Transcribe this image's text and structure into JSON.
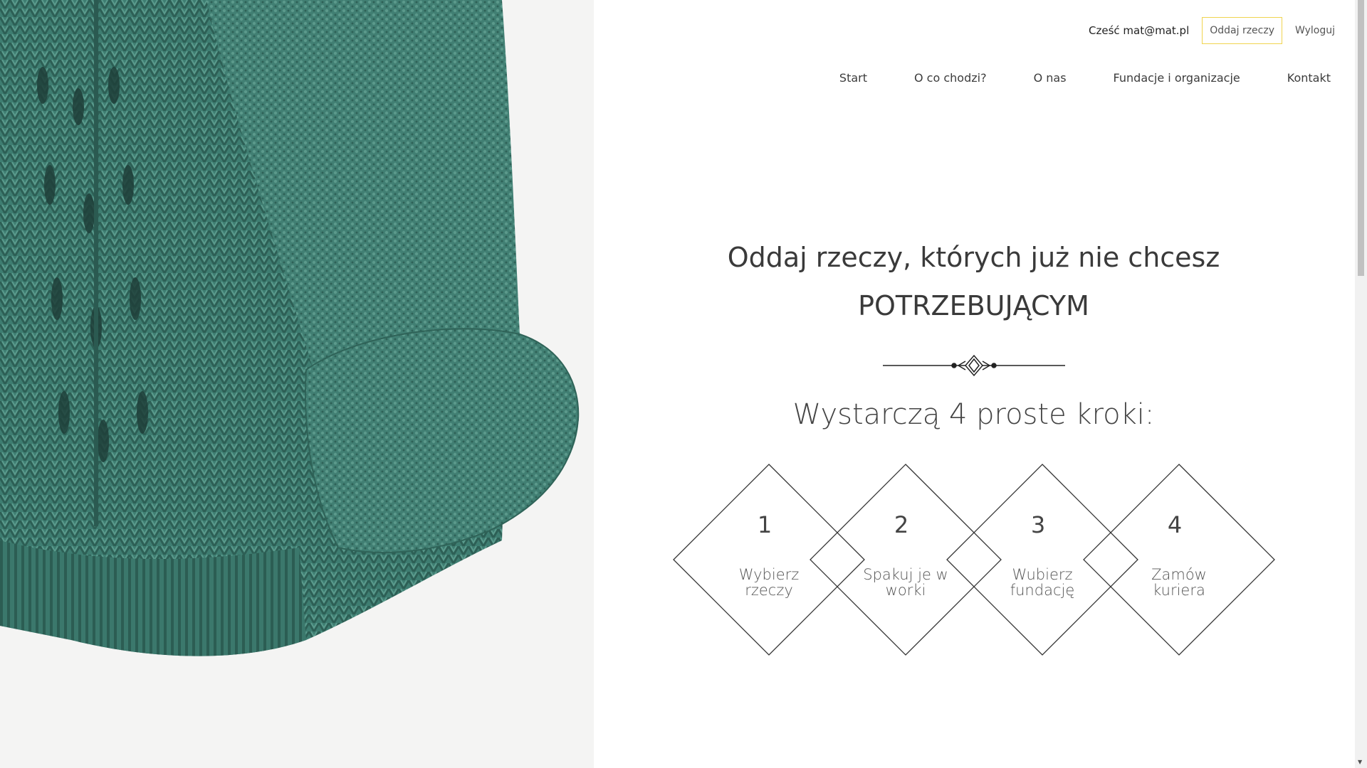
{
  "header": {
    "greeting": "Cześć mat@mat.pl",
    "give_button": "Oddaj rzeczy",
    "logout": "Wyloguj",
    "nav": [
      "Start",
      "O co chodzi?",
      "O nas",
      "Fundacje i organizacje",
      "Kontakt"
    ]
  },
  "hero": {
    "title_line1": "Oddaj rzeczy, których już nie chcesz",
    "title_line2": "POTRZEBUJĄCYM",
    "steps_heading": "Wystarczą 4 proste kroki:",
    "steps": [
      {
        "number": "1",
        "label_line1": "Wybierz",
        "label_line2": "rzeczy"
      },
      {
        "number": "2",
        "label_line1": "Spakuj je w",
        "label_line2": "worki"
      },
      {
        "number": "3",
        "label_line1": "Wubierz",
        "label_line2": "fundację"
      },
      {
        "number": "4",
        "label_line1": "Zamów",
        "label_line2": "kuriera"
      }
    ]
  },
  "colors": {
    "button_border": "#f0d44f",
    "sweater": "#3f7f72",
    "text": "#3c3c3c"
  }
}
